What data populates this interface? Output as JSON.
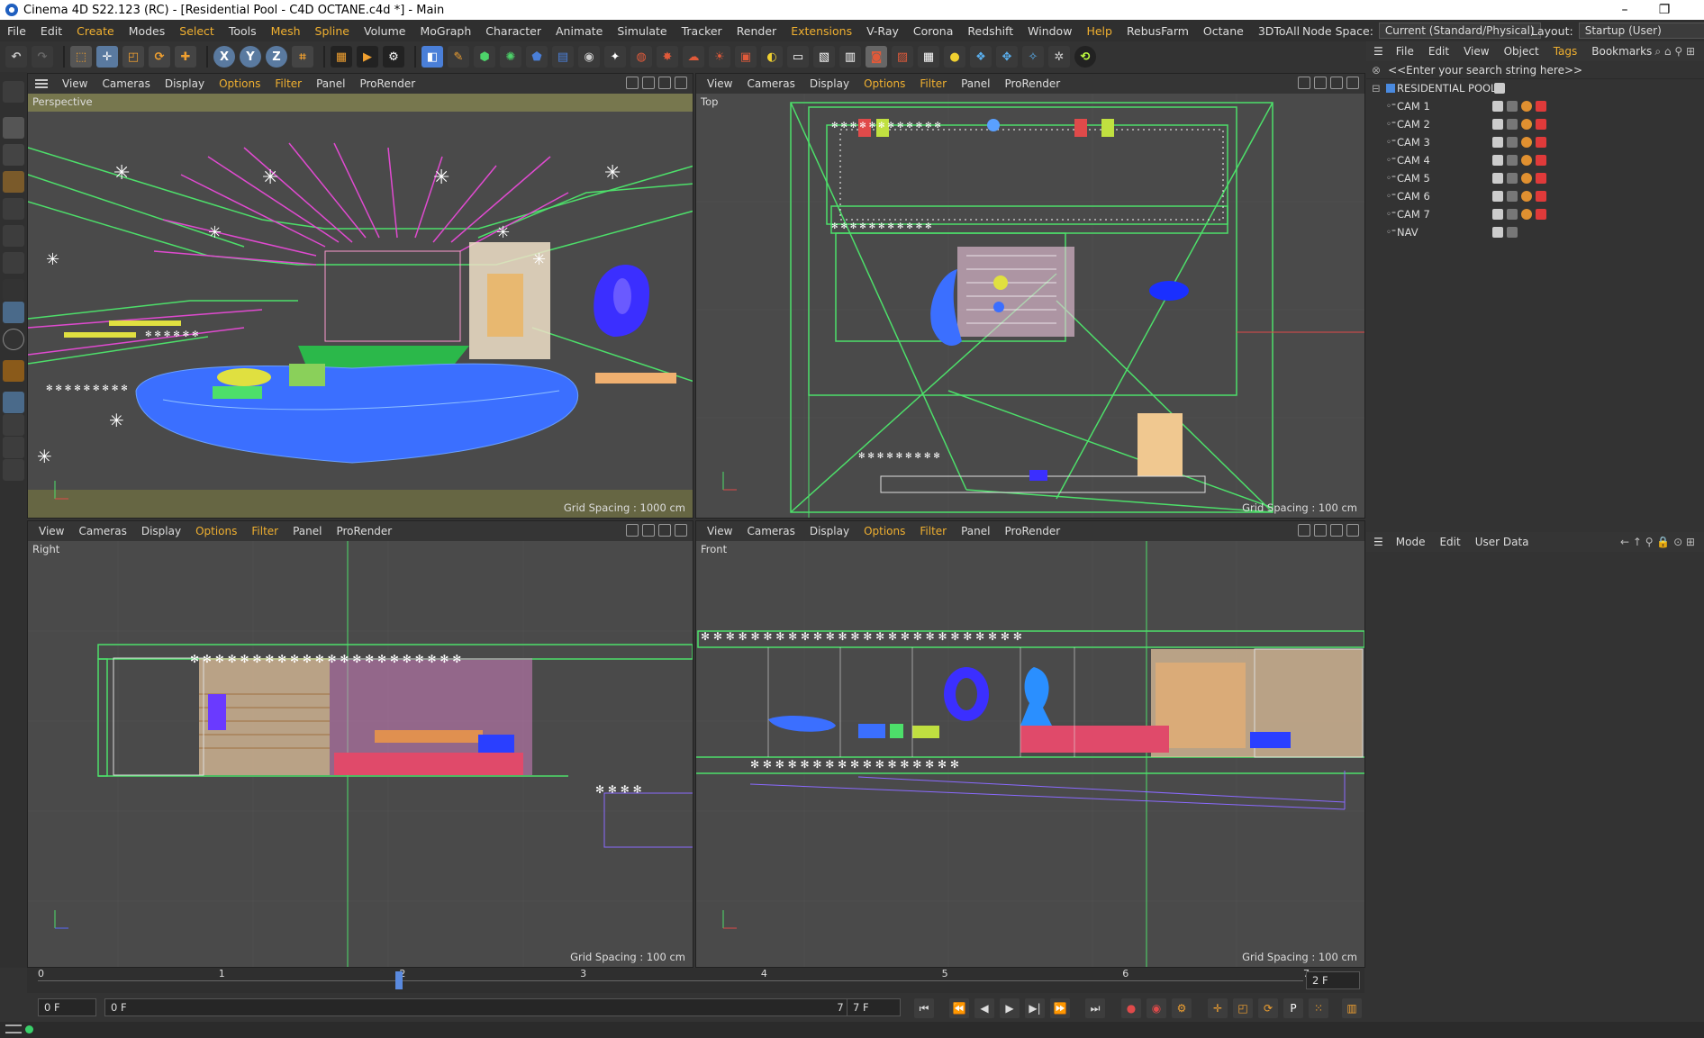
{
  "window": {
    "title": "Cinema 4D S22.123 (RC) - [Residential Pool - C4D OCTANE.c4d *] - Main",
    "minimize": "–",
    "restore": "❐",
    "close": "✕"
  },
  "menu": {
    "items": [
      "File",
      "Edit",
      "Create",
      "Modes",
      "Select",
      "Tools",
      "Mesh",
      "Spline",
      "Volume",
      "MoGraph",
      "Character",
      "Animate",
      "Simulate",
      "Tracker",
      "Render",
      "Extensions",
      "V-Ray",
      "Corona",
      "Redshift",
      "Window",
      "Help",
      "RebusFarm",
      "Octane",
      "3DToAll"
    ],
    "highlighted": [
      "Create",
      "Select",
      "Mesh",
      "Spline",
      "Extensions",
      "Help"
    ],
    "node_space_label": "Node Space:",
    "node_space_value": "Current (Standard/Physical)",
    "layout_label": "Layout:",
    "layout_value": "Startup (User)"
  },
  "toolbar": {
    "axis_x": "X",
    "axis_y": "Y",
    "axis_z": "Z"
  },
  "viewport_menu": [
    "View",
    "Cameras",
    "Display",
    "Options",
    "Filter",
    "Panel",
    "ProRender"
  ],
  "viewports": {
    "perspective": {
      "label": "Perspective",
      "grid": "Grid Spacing : 1000 cm"
    },
    "top": {
      "label": "Top",
      "grid": "Grid Spacing : 100 cm"
    },
    "right": {
      "label": "Right",
      "grid": "Grid Spacing : 100 cm"
    },
    "front": {
      "label": "Front",
      "grid": "Grid Spacing : 100 cm"
    }
  },
  "object_manager": {
    "menu": [
      "File",
      "Edit",
      "View",
      "Object",
      "Tags",
      "Bookmarks"
    ],
    "search_placeholder": "<<Enter your search string here>>",
    "root": "RESIDENTIAL POOL",
    "objects": [
      "CAM 1",
      "CAM 2",
      "CAM 3",
      "CAM 4",
      "CAM 5",
      "CAM 6",
      "CAM 7",
      "NAV"
    ]
  },
  "attribute_manager": {
    "menu": [
      "Mode",
      "Edit",
      "User Data"
    ]
  },
  "timeline": {
    "ticks": [
      "0",
      "1",
      "2",
      "3",
      "4",
      "5",
      "6",
      "7"
    ],
    "current_frame": 2,
    "end_field": "2 F"
  },
  "playback": {
    "start": "0 F",
    "range_start": "0 F",
    "range_end": "7 F",
    "end": "7 F"
  },
  "colors": {
    "accent": "#f0b030",
    "viewport_bg": "#4a4a4a",
    "wire_green": "#4ddf6a",
    "wire_blue": "#3b6fff",
    "wire_magenta": "#e04ad0"
  }
}
